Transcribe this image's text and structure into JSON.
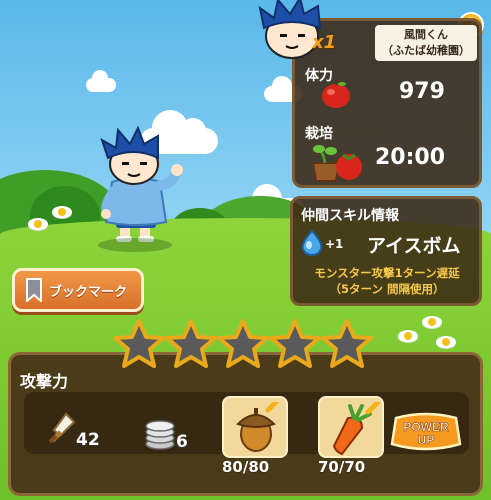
{
  "buddy": {
    "name": "風間くん",
    "affiliation": "（ふたば幼稚園）",
    "multiplier": "x1"
  },
  "stats": {
    "stamina_label": "体力",
    "stamina_value": "979",
    "cultivation_label": "栽培",
    "cultivation_value": "20:00"
  },
  "skill": {
    "heading": "仲間スキル情報",
    "level": "+1",
    "name": "アイスボム",
    "description_line1": "モンスター攻撃1ターン遅延",
    "description_line2": "（5ターン  間隔使用）"
  },
  "help_label": "?",
  "bookmark_label": "ブックマーク",
  "stars": {
    "filled": 0,
    "total": 5
  },
  "attack": {
    "label": "攻撃力",
    "sword_count": "42",
    "coin_count": "6",
    "acorn_progress": "80/80",
    "carrot_progress": "70/70",
    "power_up_line1": "POWER",
    "power_up_line2": "UP"
  },
  "colors": {
    "panel": "#3c2814",
    "accent_orange": "#f2a020",
    "skill_text": "#f6c94a"
  }
}
